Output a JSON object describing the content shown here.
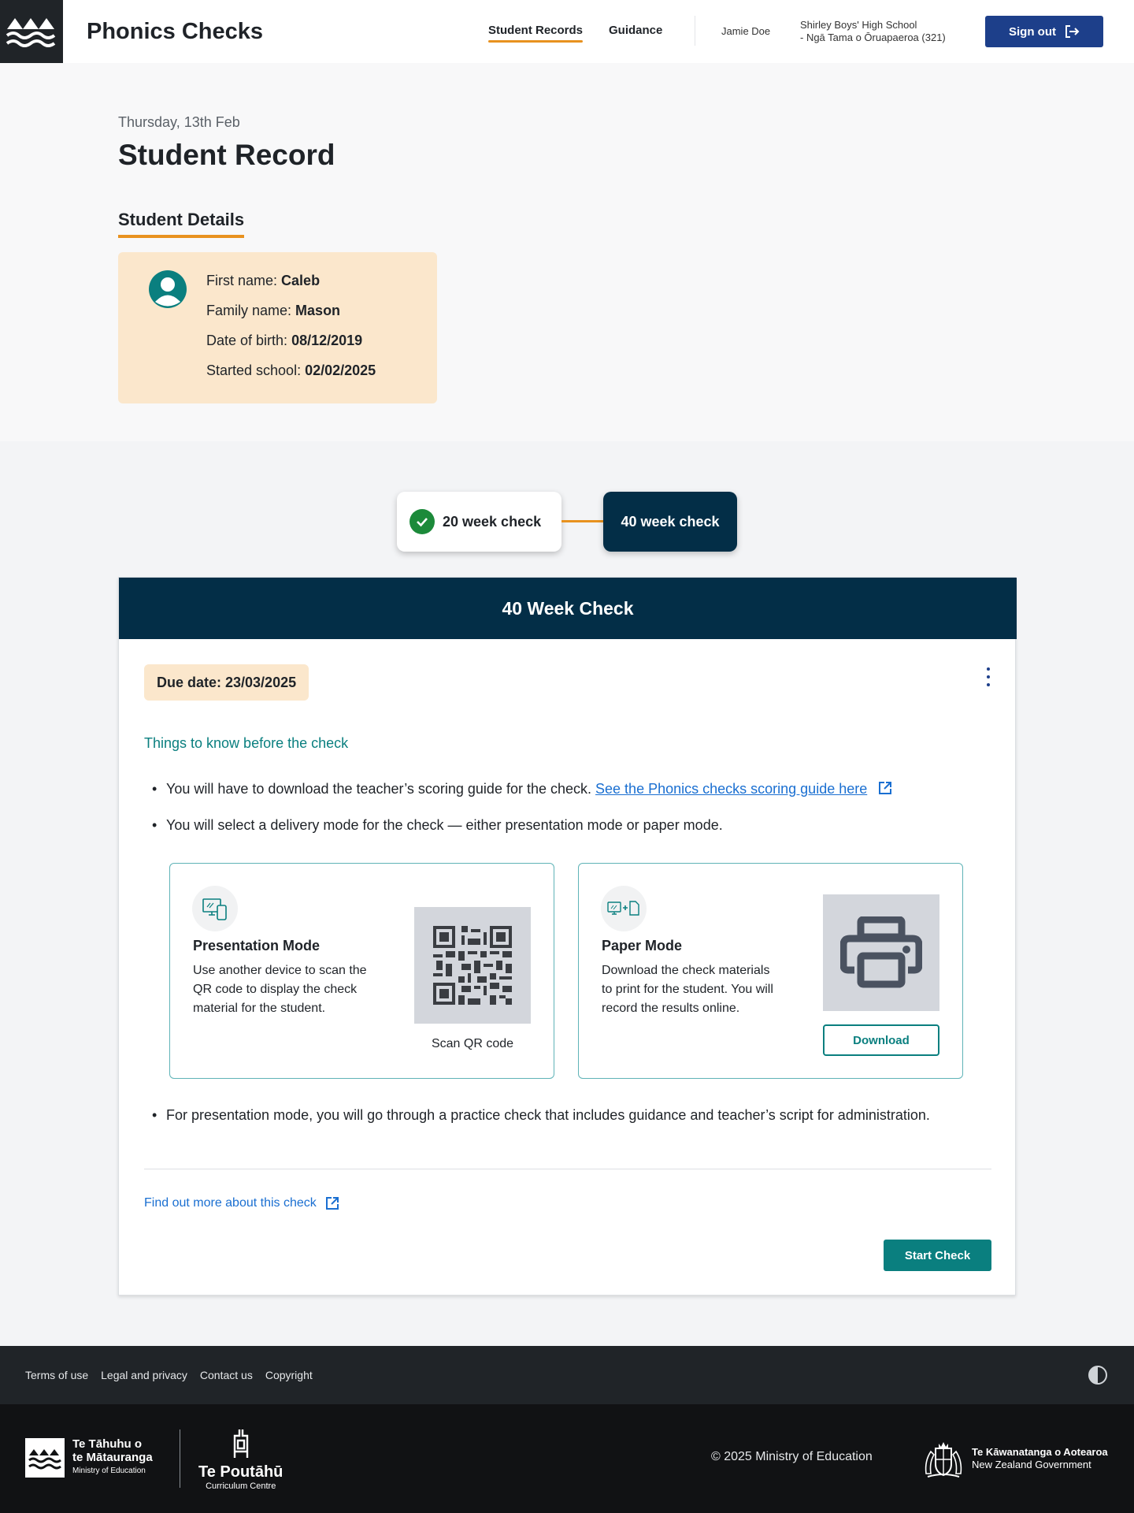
{
  "header": {
    "app_title": "Phonics Checks",
    "nav": [
      {
        "label": "Student Records",
        "active": true
      },
      {
        "label": "Guidance",
        "active": false
      }
    ],
    "user_name": "Jamie Doe",
    "school_line1": "Shirley Boys' High School",
    "school_line2": "- Ngā Tama o Ōruapaeroa (321)",
    "sign_out_label": "Sign out"
  },
  "page": {
    "date": "Thursday, 13th Feb",
    "title": "Student Record",
    "details_tab": "Student Details"
  },
  "student": {
    "first_name_label": "First name:",
    "first_name": "Caleb",
    "family_name_label": "Family name:",
    "family_name": "Mason",
    "dob_label": "Date of birth:",
    "dob": "08/12/2019",
    "started_label": "Started school:",
    "started": "02/02/2025"
  },
  "steps": [
    {
      "label": "20 week check",
      "status": "complete"
    },
    {
      "label": "40 week check",
      "status": "current"
    }
  ],
  "check": {
    "title": "40 Week Check",
    "due_date": "Due date: 23/03/2025",
    "things_title": "Things to know before the check",
    "bullet1_text": "You will have to download the teacher’s scoring guide for the check.",
    "bullet1_link": "See the Phonics checks scoring guide here",
    "bullet2_text": "You will select a delivery mode for the check — either presentation mode or paper mode.",
    "bullet3_text": "For presentation mode, you will go through a practice check that includes guidance and teacher’s script for administration.",
    "presentation": {
      "title": "Presentation Mode",
      "description": "Use another device to scan the QR code to display the check material for the student.",
      "qr_caption": "Scan QR code"
    },
    "paper": {
      "title": "Paper Mode",
      "description": "Download the check materials to print for the student. You will record the results online.",
      "download_label": "Download"
    },
    "find_more": "Find out more about this check",
    "start_label": "Start Check"
  },
  "footer": {
    "links": [
      "Terms of use",
      "Legal and privacy",
      "Contact us",
      "Copyright"
    ],
    "moe_line1": "Te Tāhuhu o",
    "moe_line2": "te Mātauranga",
    "moe_sub": "Ministry of Education",
    "poutahu_name": "Te Poutāhū",
    "poutahu_sub": "Curriculum Centre",
    "copyright": "© 2025 Ministry of Education",
    "govt_line1": "Te Kāwanatanga o Aotearoa",
    "govt_line2": "New Zealand Government"
  },
  "colors": {
    "navy": "#032e47",
    "accent_orange": "#e8921f",
    "teal": "#0a7f7f",
    "link_blue": "#1a6fd1",
    "signout_blue": "#1d3f8a",
    "peach": "#fbe7cc"
  }
}
